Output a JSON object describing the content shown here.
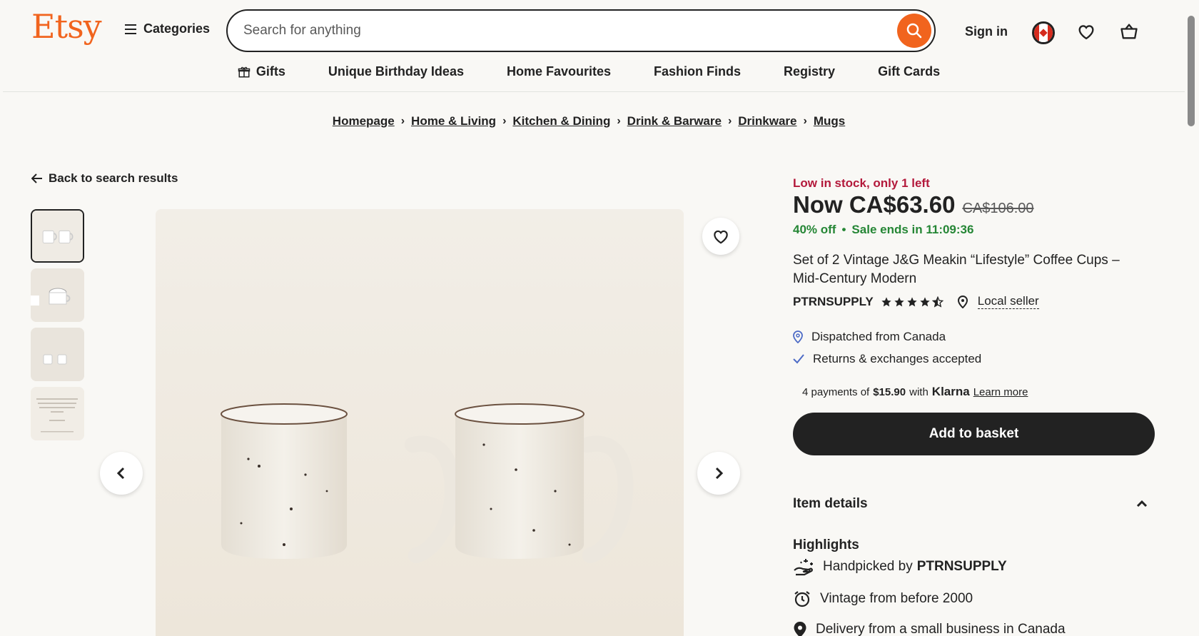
{
  "header": {
    "logo": "Etsy",
    "categories_label": "Categories",
    "search_placeholder": "Search for anything",
    "signin_label": "Sign in"
  },
  "nav": {
    "items": [
      {
        "label": "Gifts",
        "icon": "gift-icon"
      },
      {
        "label": "Unique Birthday Ideas"
      },
      {
        "label": "Home Favourites"
      },
      {
        "label": "Fashion Finds"
      },
      {
        "label": "Registry"
      },
      {
        "label": "Gift Cards"
      }
    ]
  },
  "breadcrumb": [
    "Homepage",
    "Home & Living",
    "Kitchen & Dining",
    "Drink & Barware",
    "Drinkware",
    "Mugs"
  ],
  "back_label": "Back to search results",
  "listing": {
    "stock": "Low in stock, only 1 left",
    "price": "Now CA$63.60",
    "old_price": "CA$106.00",
    "discount": "40% off",
    "sale_ends": "Sale ends in 11:09:36",
    "title": "Set of 2 Vintage J&G Meakin “Lifestyle” Coffee Cups – Mid-Century Modern",
    "shop": "PTRNSUPPLY",
    "rating": 4.5,
    "local_seller": "Local seller",
    "dispatch": "Dispatched from Canada",
    "returns": "Returns & exchanges accepted",
    "klarna": {
      "prefix": "4 payments of",
      "amount": "$15.90",
      "with": "with",
      "brand": "Klarna",
      "learn_more": "Learn more"
    },
    "add_to_basket": "Add to basket",
    "item_details": "Item details",
    "highlights_label": "Highlights",
    "highlights": {
      "handpicked_prefix": "Handpicked by",
      "handpicked_shop": "PTRNSUPPLY",
      "vintage": "Vintage from before 2000",
      "delivery": "Delivery from a small business in Canada"
    }
  },
  "colors": {
    "brand": "#f1641e",
    "sale_green": "#258635",
    "stock_red": "#b3193b",
    "button_dark": "#222222"
  }
}
